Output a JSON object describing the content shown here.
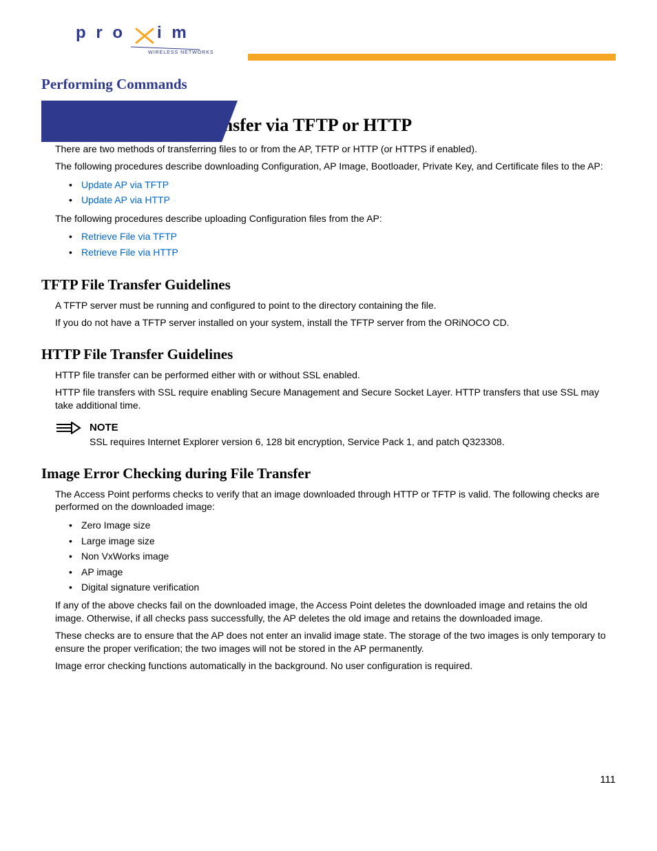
{
  "header": {
    "brand_main": "proxim",
    "brand_sub": "WIRELESS NETWORKS",
    "section_title": "Performing Commands"
  },
  "main_heading": "Introduction to File Transfer via TFTP or HTTP",
  "intro_p1": "There are two methods of transferring files to or from the AP, TFTP or HTTP (or HTTPS if enabled).",
  "intro_p2": "The following procedures describe downloading Configuration, AP Image, Bootloader, Private Key, and Certificate files to the AP:",
  "download_links": [
    "Update AP via TFTP",
    "Update AP via HTTP"
  ],
  "intro_p3": "The following procedures describe uploading Configuration files from the AP:",
  "upload_links": [
    "Retrieve File via TFTP",
    "Retrieve File via HTTP"
  ],
  "tftp": {
    "heading": "TFTP File Transfer Guidelines",
    "p1": "A TFTP server must be running and configured to point to the directory containing the file.",
    "p2": "If you do not have a TFTP server installed on your system, install the TFTP server from the ORiNOCO CD."
  },
  "http": {
    "heading": "HTTP File Transfer Guidelines",
    "p1": "HTTP file transfer can be performed either with or without SSL enabled.",
    "p2": "HTTP file transfers with SSL require enabling Secure Management and Secure Socket Layer. HTTP transfers that use SSL may take additional time."
  },
  "note": {
    "label": "NOTE",
    "text": "SSL requires Internet Explorer version 6, 128 bit encryption, Service Pack 1, and patch Q323308."
  },
  "image_check": {
    "heading": "Image Error Checking during File Transfer",
    "p1": "The Access Point performs checks to verify that an image downloaded through HTTP or TFTP is valid. The following checks are performed on the downloaded image:",
    "items": [
      "Zero Image size",
      "Large image size",
      "Non VxWorks image",
      "AP image",
      "Digital signature verification"
    ],
    "p2": "If any of the above checks fail on the downloaded image, the Access Point deletes the downloaded image and retains the old image. Otherwise, if all checks pass successfully, the AP deletes the old image and retains the downloaded image.",
    "p3": "These checks are to ensure that the AP does not enter an invalid image state. The storage of the two images is only temporary to ensure the proper verification; the two images will not be stored in the AP permanently.",
    "p4": "Image error checking functions automatically in the background. No user configuration is required."
  },
  "page_number": "111"
}
